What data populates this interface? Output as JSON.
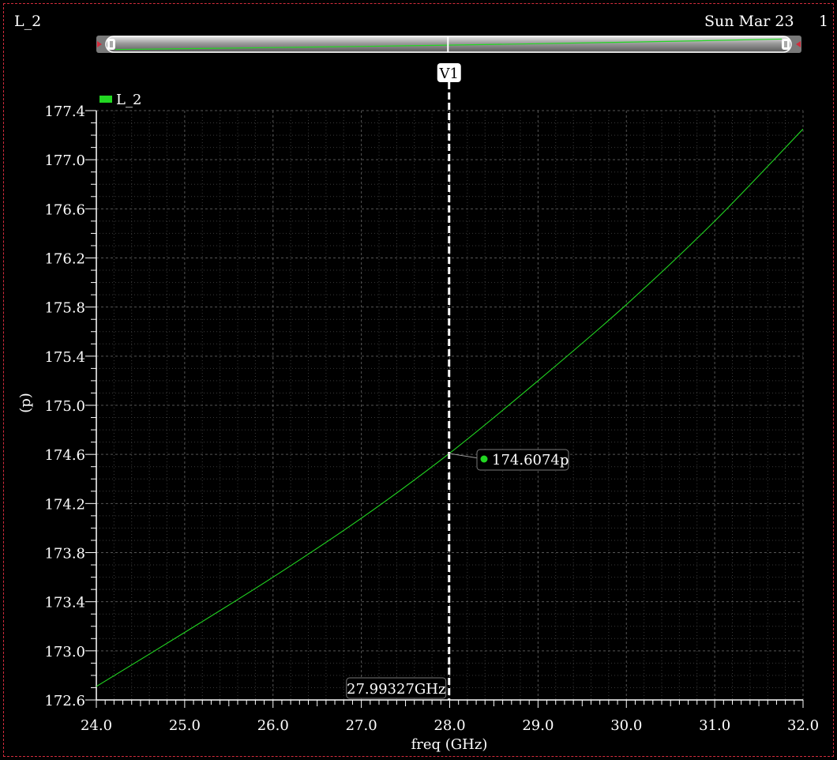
{
  "window": {
    "title": "L_2",
    "date": "Sun Mar 23",
    "clipped_text": "1"
  },
  "colors": {
    "background": "#000000",
    "trace": "#22d722",
    "grid": "#4a4a4a",
    "border": "#d22c3c"
  },
  "marker": {
    "name": "V1",
    "x_readout": "27.99327GHz",
    "y_readout": "174.6074p",
    "x": 27.99327,
    "y": 174.6074
  },
  "chart_data": {
    "type": "line",
    "xlabel": "freq (GHz)",
    "ylabel": "(p)",
    "xlim": [
      24.0,
      32.0
    ],
    "ylim": [
      172.6,
      177.4
    ],
    "xticks": [
      "24.0",
      "25.0",
      "26.0",
      "27.0",
      "28.0",
      "29.0",
      "30.0",
      "31.0",
      "32.0"
    ],
    "yticks": [
      "172.6",
      "173.0",
      "173.4",
      "173.8",
      "174.2",
      "174.6",
      "175.0",
      "175.4",
      "175.8",
      "176.2",
      "176.6",
      "177.0",
      "177.4"
    ],
    "grid": true,
    "legend": "top-left",
    "series": [
      {
        "name": "L_2",
        "x": [
          24.0,
          25.0,
          26.0,
          27.0,
          28.0,
          29.0,
          30.0,
          31.0,
          32.0
        ],
        "y": [
          172.71,
          173.15,
          173.6,
          174.08,
          174.61,
          175.2,
          175.82,
          176.5,
          177.25
        ]
      }
    ]
  }
}
